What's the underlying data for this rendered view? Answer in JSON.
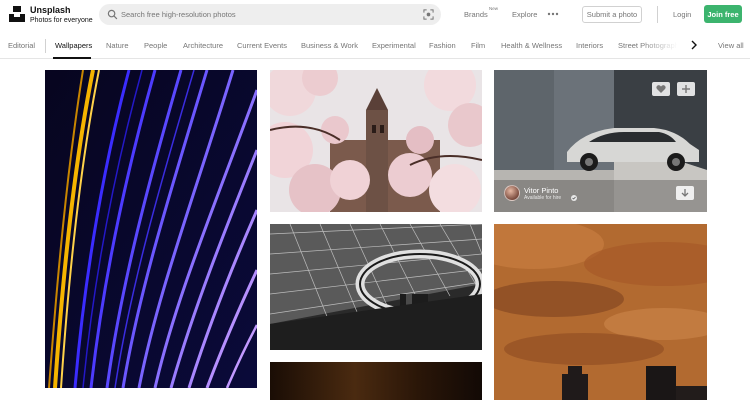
{
  "brand": {
    "name": "Unsplash",
    "tagline": "Photos for everyone"
  },
  "search": {
    "placeholder": "Search free high-resolution photos"
  },
  "header": {
    "brands_label": "Brands",
    "brands_badge": "New",
    "explore_label": "Explore",
    "submit_label": "Submit a photo",
    "login_label": "Login",
    "join_label": "Join free"
  },
  "categories": {
    "items": [
      "Editorial",
      "Wallpapers",
      "Nature",
      "People",
      "Architecture",
      "Current Events",
      "Business & Work",
      "Experimental",
      "Fashion",
      "Film",
      "Health & Wellness",
      "Interiors",
      "Street Photograph"
    ],
    "active": "Wallpapers",
    "view_all": "View all"
  },
  "photos": {
    "featured_author": {
      "name": "Vitor Pinto",
      "status": "Available for hire"
    }
  },
  "colors": {
    "accent_green": "#3cb46e",
    "muted_text": "#767676",
    "search_bg": "#eeeeee"
  },
  "icons": [
    "logo-icon",
    "search-icon",
    "visual-search-icon",
    "more-icon",
    "chevron-right-icon",
    "heart-icon",
    "plus-icon",
    "download-icon",
    "check-icon"
  ]
}
